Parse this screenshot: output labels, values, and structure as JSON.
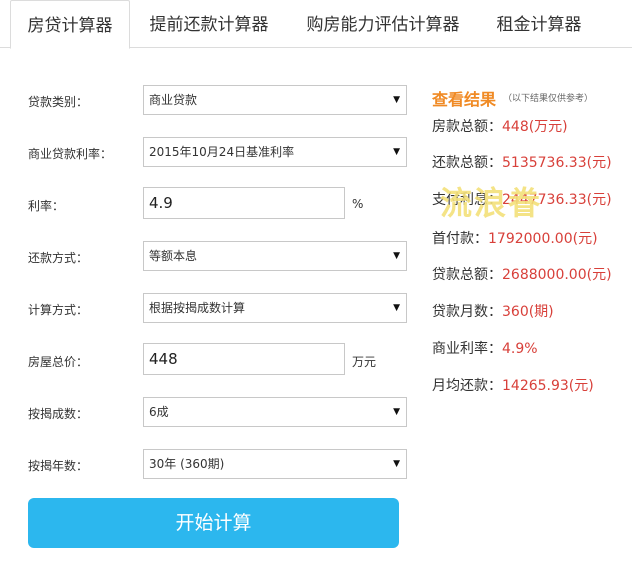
{
  "tabs": [
    {
      "label": "房贷计算器"
    },
    {
      "label": "提前还款计算器"
    },
    {
      "label": "购房能力评估计算器"
    },
    {
      "label": "租金计算器"
    }
  ],
  "form": {
    "loan_type": {
      "label": "贷款类别：",
      "value": "商业贷款"
    },
    "rate_type": {
      "label": "商业贷款利率：",
      "value": "2015年10月24日基准利率"
    },
    "rate": {
      "label": "利率：",
      "value": "4.9",
      "unit": "%"
    },
    "repay_method": {
      "label": "还款方式：",
      "value": "等额本息"
    },
    "calc_method": {
      "label": "计算方式：",
      "value": "根据按揭成数计算"
    },
    "house_price": {
      "label": "房屋总价：",
      "value": "448",
      "unit": "万元"
    },
    "down_ratio": {
      "label": "按揭成数：",
      "value": "6成"
    },
    "years": {
      "label": "按揭年数：",
      "value": "30年 (360期)"
    },
    "submit_label": "开始计算"
  },
  "results": {
    "title": "查看结果",
    "note": "（以下结果仅供参考）",
    "items": [
      {
        "label": "房款总额：",
        "value": "448(万元)"
      },
      {
        "label": "还款总额：",
        "value": "5135736.33(元)"
      },
      {
        "label": "支付利息：",
        "value": "2447736.33(元)"
      },
      {
        "label": "首付款：",
        "value": "1792000.00(元)"
      },
      {
        "label": "贷款总额：",
        "value": "2688000.00(元)"
      },
      {
        "label": "贷款月数：",
        "value": "360(期)"
      },
      {
        "label": "商业利率：",
        "value": "4.9%"
      },
      {
        "label": "月均还款：",
        "value": "14265.93(元)"
      }
    ]
  },
  "watermark": "流浪眷"
}
